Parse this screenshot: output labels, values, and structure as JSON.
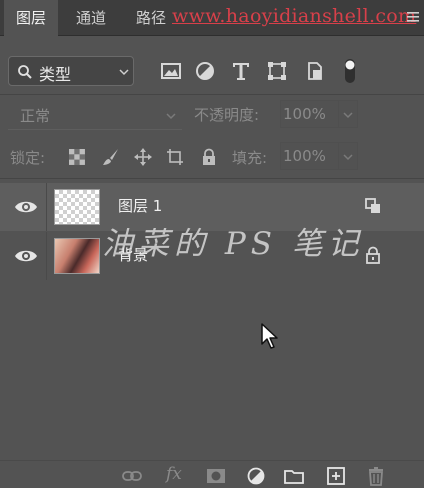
{
  "tabs": [
    {
      "label": "图层",
      "active": true
    },
    {
      "label": "通道",
      "active": false
    },
    {
      "label": "路径",
      "active": false
    }
  ],
  "watermark_url": "www.haoyidianshell.com",
  "filter": {
    "kind_label": "类型",
    "icons": [
      "image-filter-icon",
      "adjustment-filter-icon",
      "type-filter-icon",
      "shape-filter-icon",
      "smart-object-filter-icon",
      "filter-toggle-icon"
    ]
  },
  "blend": {
    "mode": "正常",
    "opacity_label": "不透明度:",
    "opacity_value": "100%"
  },
  "lock": {
    "label": "锁定:",
    "fill_label": "填充:",
    "fill_value": "100%"
  },
  "layers": [
    {
      "name": "图层 1",
      "visible": true,
      "selected": true,
      "thumb": "transparent",
      "badge": "linked-icon"
    },
    {
      "name": "背景",
      "visible": true,
      "selected": false,
      "thumb": "photo",
      "badge": "lock-icon"
    }
  ],
  "overlay_text": "油菜的 PS 笔记",
  "colors": {
    "panel": "#535353",
    "tabbar": "#3d3d3d",
    "selected_row": "#5e5e5e",
    "watermark": "#d8404a"
  }
}
